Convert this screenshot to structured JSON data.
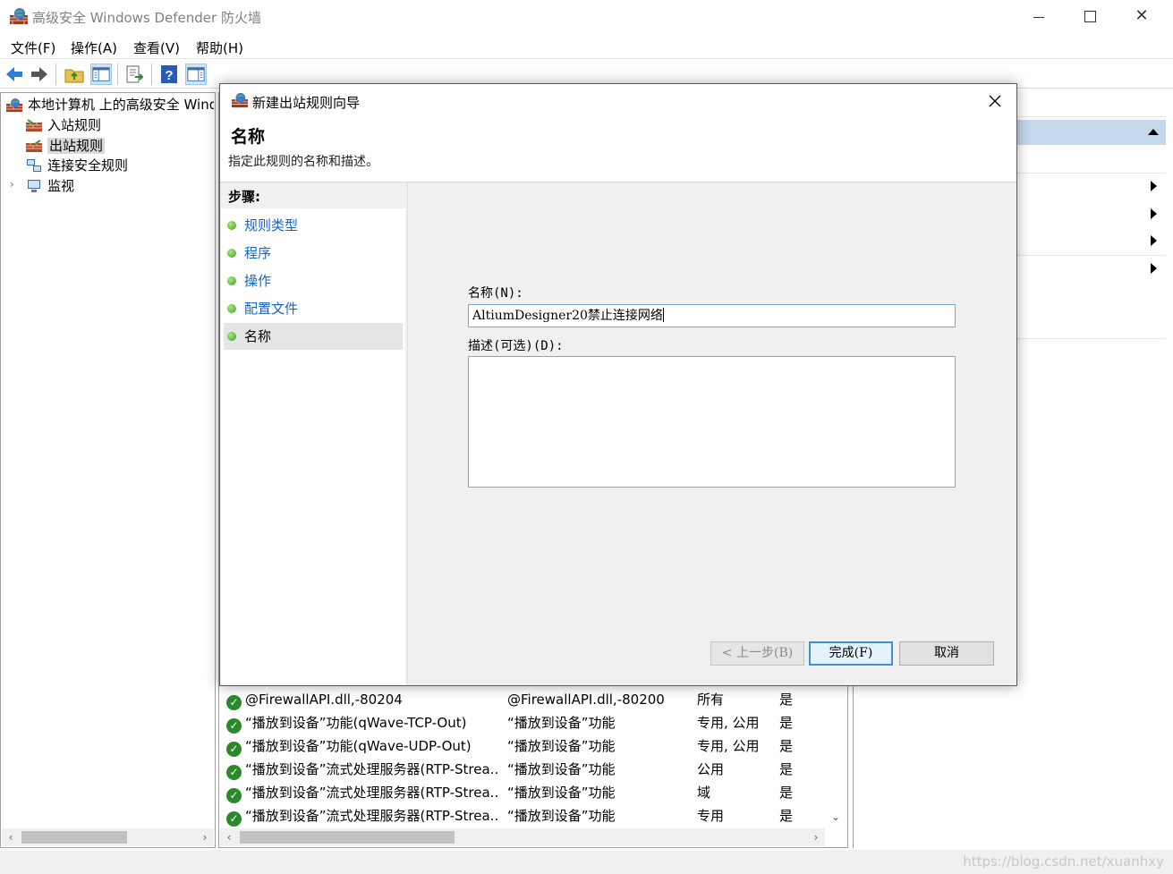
{
  "window": {
    "title": "高级安全 Windows Defender 防火墙",
    "close_glyph": "✕"
  },
  "menu": [
    "文件(F)",
    "操作(A)",
    "查看(V)",
    "帮助(H)"
  ],
  "tree": {
    "root": "本地计算机 上的高级安全 Windows Defender 防火墙",
    "items": [
      "入站规则",
      "出站规则",
      "连接安全规则",
      "监视"
    ],
    "expander_glyph": "›"
  },
  "rules": [
    {
      "name": "@FirewallAPI.dll,-80204",
      "group": "@FirewallAPI.dll,-80200",
      "profile": "所有",
      "enabled": "是"
    },
    {
      "name": "“播放到设备”功能(qWave-TCP-Out)",
      "group": "“播放到设备”功能",
      "profile": "专用, 公用",
      "enabled": "是"
    },
    {
      "name": "“播放到设备”功能(qWave-UDP-Out)",
      "group": "“播放到设备”功能",
      "profile": "专用, 公用",
      "enabled": "是"
    },
    {
      "name": "“播放到设备”流式处理服务器(RTP-Strea...",
      "group": "“播放到设备”功能",
      "profile": "公用",
      "enabled": "是"
    },
    {
      "name": "“播放到设备”流式处理服务器(RTP-Strea...",
      "group": "“播放到设备”功能",
      "profile": "域",
      "enabled": "是"
    },
    {
      "name": "“播放到设备”流式处理服务器(RTP-Strea...",
      "group": "“播放到设备”功能",
      "profile": "专用",
      "enabled": "是"
    }
  ],
  "check_glyph": "✓",
  "scroll": {
    "left": "‹",
    "right": "›",
    "down": "⌄"
  },
  "dialog": {
    "title": "新建出站规则向导",
    "close_glyph": "✕",
    "header_title": "名称",
    "header_desc": "指定此规则的名称和描述。",
    "steps_label": "步骤:",
    "steps": [
      "规则类型",
      "程序",
      "操作",
      "配置文件",
      "名称"
    ],
    "current_step": "名称",
    "name_label": "名称(N):",
    "name_value": "AltiumDesigner20禁止连接网络",
    "desc_label": "描述(可选)(D):",
    "desc_value": "",
    "buttons": {
      "back": "< 上一步(B)",
      "finish": "完成(F)",
      "cancel": "取消"
    }
  },
  "watermark": "https://blog.csdn.net/xuanhxy",
  "colors": {
    "link": "#1464c8",
    "selected_bg": "#d9d9d9",
    "actions_header": "#c5d7ea",
    "primary_border": "#3d8fd9"
  }
}
